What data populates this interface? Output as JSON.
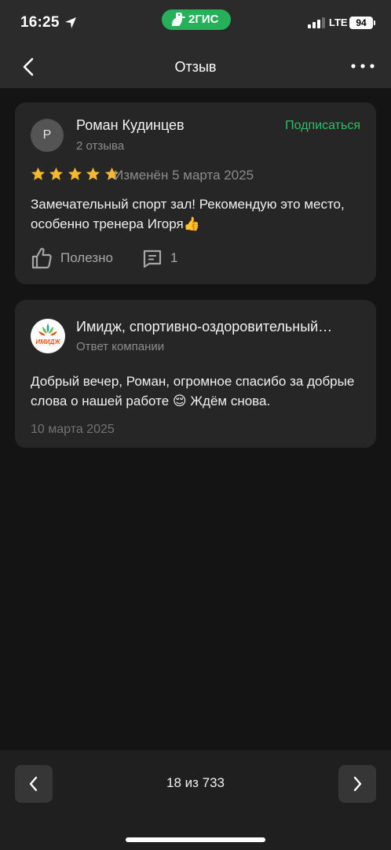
{
  "status_bar": {
    "time": "16:25",
    "app_label": "2ГИС",
    "network": "LTE",
    "battery": "94"
  },
  "nav": {
    "title": "Отзыв",
    "back_icon": "chevron-left-icon",
    "more_icon": "more-dots-icon"
  },
  "review": {
    "avatar_letter": "Р",
    "author": "Роман Кудинцев",
    "reviews_count": "2 отзыва",
    "subscribe_label": "Подписаться",
    "rating": 5,
    "changed": "Изменён 5 марта 2025",
    "text": "Замечательный спорт зал! Рекомендую это место, особенно тренера Игоря👍",
    "useful_label": "Полезно",
    "comments_count": "1"
  },
  "reply": {
    "logo_text": "ИМИДЖ",
    "company": "Имидж, спортивно-оздоровительный…",
    "subtitle": "Ответ компании",
    "text": "Добрый вечер, Роман, огромное спасибо за добрые слова о нашей работе 😌 Ждём снова.",
    "date": "10 марта 2025"
  },
  "pager": {
    "text": "18 из 733"
  },
  "colors": {
    "accent_green": "#2fbf62",
    "star_yellow": "#f5b82e",
    "card_bg": "#262626",
    "page_bg": "#141414"
  }
}
